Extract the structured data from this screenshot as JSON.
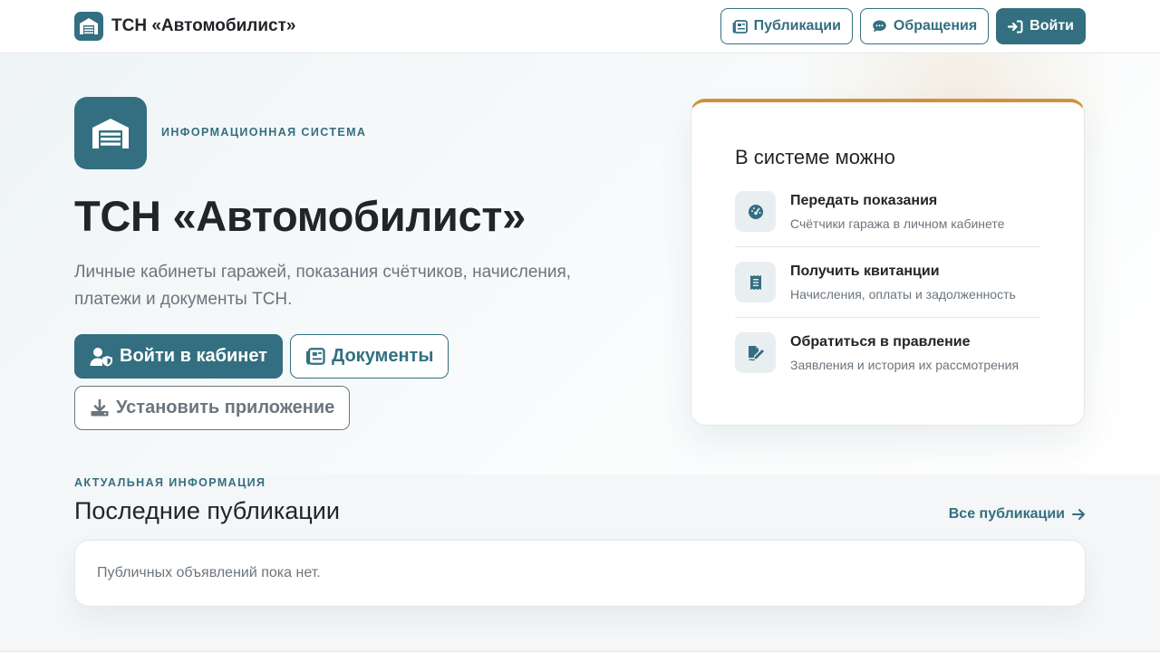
{
  "navbar": {
    "brand_title": "ТСН «Автомобилист»",
    "brand_icon": "garage-icon",
    "publications_label": "Публикации",
    "appeals_label": "Обращения",
    "login_label": "Войти"
  },
  "hero": {
    "eyebrow": "ИНФОРМАЦИОННАЯ СИСТЕМА",
    "title": "ТСН «Автомобилист»",
    "description_line1": "Личные кабинеты гаражей, показания счётчиков, начисления,",
    "description_line2": "платежи и документы ТСН.",
    "cabinet_button": "Войти в кабинет",
    "documents_button": "Документы",
    "install_button": "Установить приложение"
  },
  "card": {
    "title": "В системе можно",
    "features": [
      {
        "title": "Передать показания",
        "subtitle": "Счётчики гаража в личном кабинете",
        "icon": "gauge-icon"
      },
      {
        "title": "Получить квитанции",
        "subtitle": "Начисления, оплаты и задолженность",
        "icon": "receipt-icon"
      },
      {
        "title": "Обратиться в правление",
        "subtitle": "Заявления и история их рассмотрения",
        "icon": "signature-icon"
      }
    ]
  },
  "publications": {
    "eyebrow": "АКТУАЛЬНАЯ ИНФОРМАЦИЯ",
    "title": "Последние публикации",
    "all_link": "Все публикации",
    "empty_text": "Публичных объявлений пока нет."
  },
  "colors": {
    "primary": "#336f80",
    "accent": "#cf923c",
    "muted_text": "#6c757d",
    "text": "#212529"
  }
}
